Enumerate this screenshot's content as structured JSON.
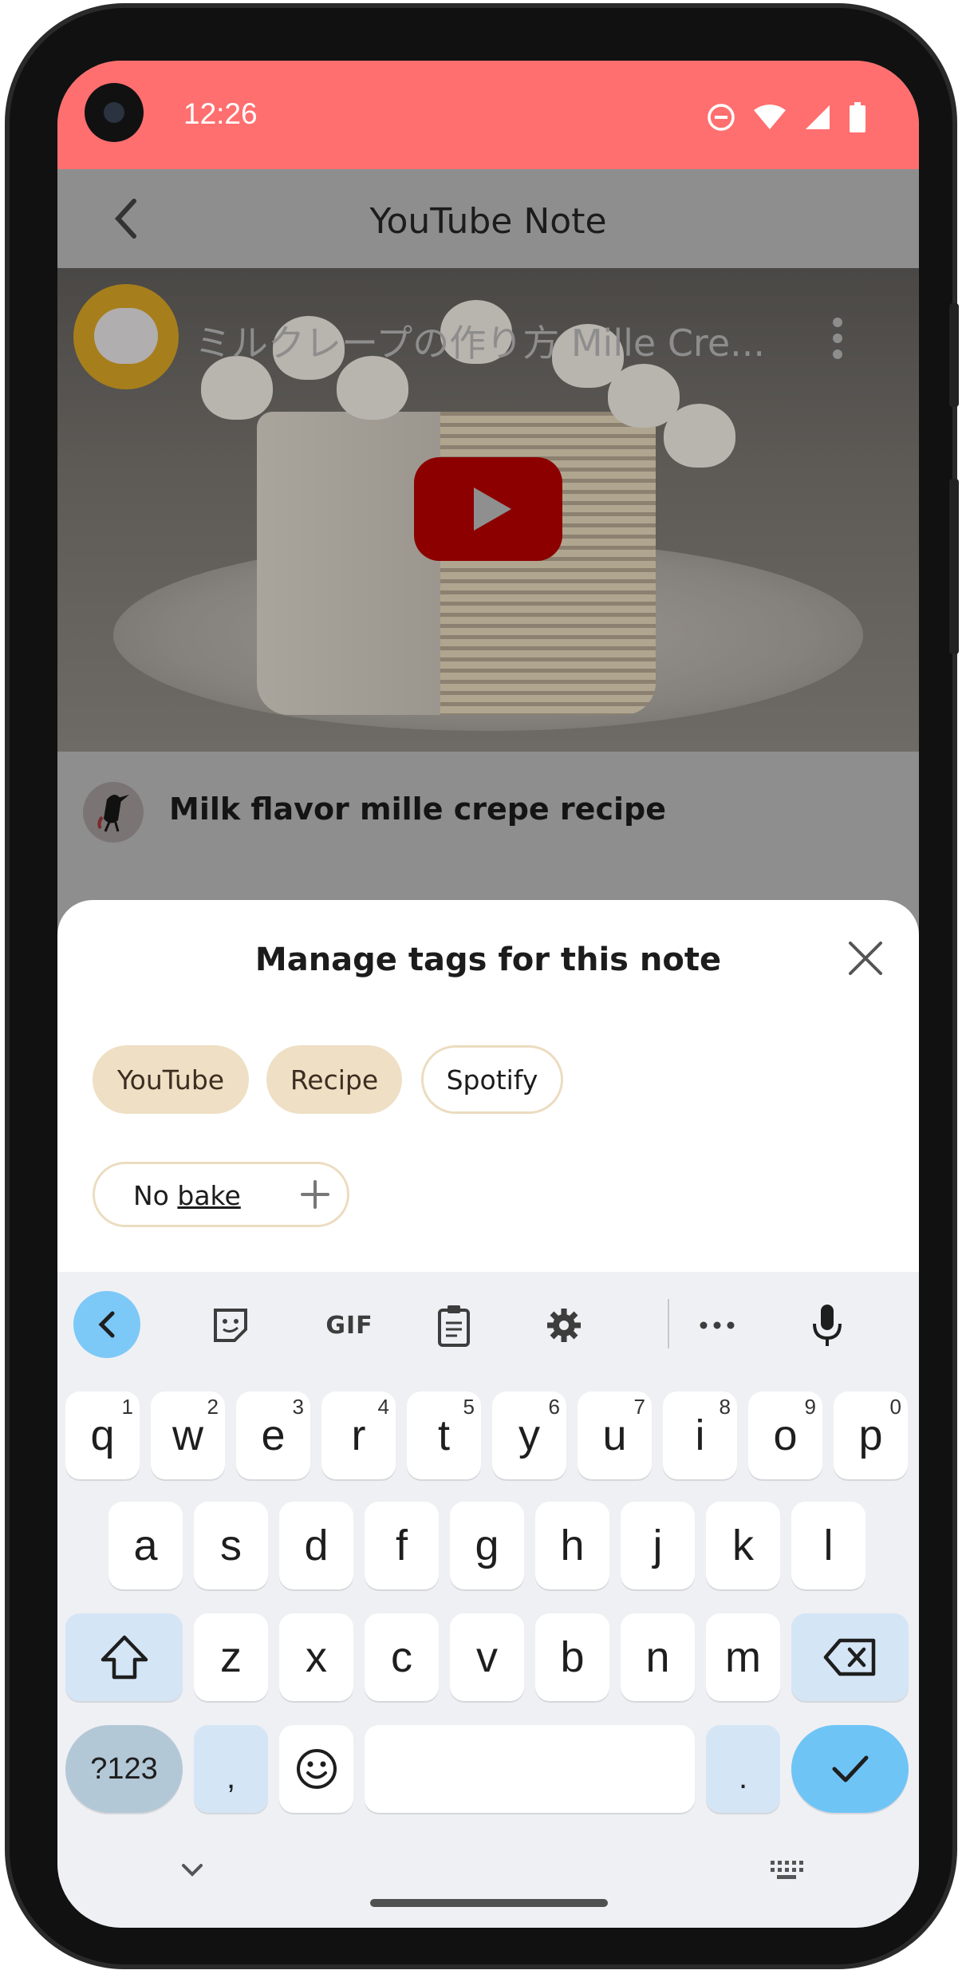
{
  "status_bar": {
    "time": "12:26",
    "icons": [
      "do-not-disturb-icon",
      "wifi-icon",
      "signal-icon",
      "battery-icon"
    ]
  },
  "app_bar": {
    "title": "YouTube Note"
  },
  "video": {
    "title": "ミルクレープの作り方 Mille Cre..."
  },
  "note": {
    "title": "Milk flavor mille crepe recipe"
  },
  "sheet": {
    "title": "Manage tags for this note",
    "chips": [
      {
        "label": "YouTube",
        "selected": true
      },
      {
        "label": "Recipe",
        "selected": true
      },
      {
        "label": "Spotify",
        "selected": false
      }
    ],
    "input": {
      "value_part1": "No ",
      "value_part2": "bake"
    }
  },
  "keyboard": {
    "toolbar": {
      "gif_label": "GIF"
    },
    "row1": [
      {
        "key": "q",
        "hint": "1"
      },
      {
        "key": "w",
        "hint": "2"
      },
      {
        "key": "e",
        "hint": "3"
      },
      {
        "key": "r",
        "hint": "4"
      },
      {
        "key": "t",
        "hint": "5"
      },
      {
        "key": "y",
        "hint": "6"
      },
      {
        "key": "u",
        "hint": "7"
      },
      {
        "key": "i",
        "hint": "8"
      },
      {
        "key": "o",
        "hint": "9"
      },
      {
        "key": "p",
        "hint": "0"
      }
    ],
    "row2": [
      "a",
      "s",
      "d",
      "f",
      "g",
      "h",
      "j",
      "k",
      "l"
    ],
    "row3": [
      "z",
      "x",
      "c",
      "v",
      "b",
      "n",
      "m"
    ],
    "row4": {
      "symbols": "?123",
      "comma": ",",
      "period": "."
    }
  },
  "colors": {
    "status_bar": "#ff6f6f",
    "chip_selected": "#eedfc5",
    "keyboard_accent": "#6fc4f6"
  }
}
